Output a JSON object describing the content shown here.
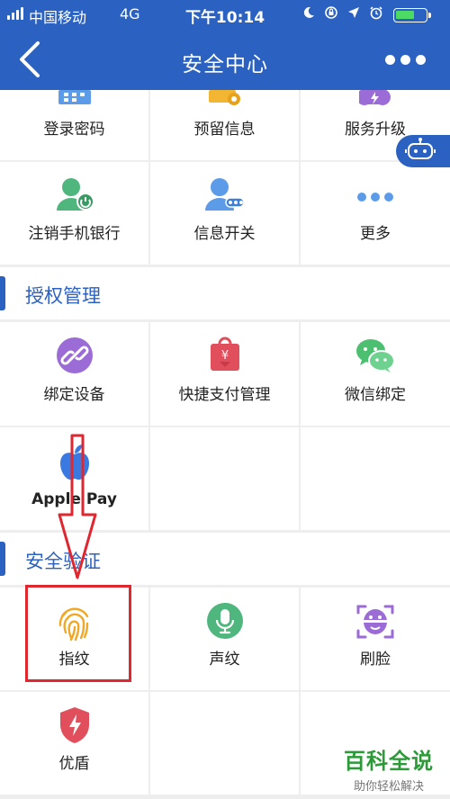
{
  "status_bar": {
    "carrier": "中国移动",
    "network": "4G",
    "time": "下午10:14",
    "battery_level": 0.65,
    "battery_color": "#4cd964"
  },
  "nav": {
    "title": "安全中心",
    "back_icon": "chevron-left-icon",
    "more_icon": "more-dots-icon"
  },
  "account_grid": [
    {
      "label": "登录密码",
      "icon": "calendar-grid-icon"
    },
    {
      "label": "预留信息",
      "icon": "info-card-icon"
    },
    {
      "label": "服务升级",
      "icon": "upgrade-icon"
    },
    {
      "label": "注销手机银行",
      "icon": "user-cancel-icon"
    },
    {
      "label": "信息开关",
      "icon": "user-toggle-icon"
    },
    {
      "label": "更多",
      "icon": "more-dots-icon"
    }
  ],
  "auth_section": {
    "title": "授权管理",
    "items": [
      {
        "label": "绑定设备",
        "icon": "link-icon"
      },
      {
        "label": "快捷支付管理",
        "icon": "payment-bag-icon"
      },
      {
        "label": "微信绑定",
        "icon": "wechat-icon"
      },
      {
        "label": "Apple Pay",
        "icon": "apple-icon"
      }
    ]
  },
  "verify_section": {
    "title": "安全验证",
    "items": [
      {
        "label": "指纹",
        "icon": "fingerprint-icon"
      },
      {
        "label": "声纹",
        "icon": "microphone-icon"
      },
      {
        "label": "刷脸",
        "icon": "face-scan-icon"
      },
      {
        "label": "优盾",
        "icon": "shield-icon"
      }
    ]
  },
  "colors": {
    "primary": "#2b62c1",
    "annotation_red": "#e0262f"
  },
  "watermark": {
    "brand": "百科全说",
    "slogan": "助你轻松解决"
  }
}
